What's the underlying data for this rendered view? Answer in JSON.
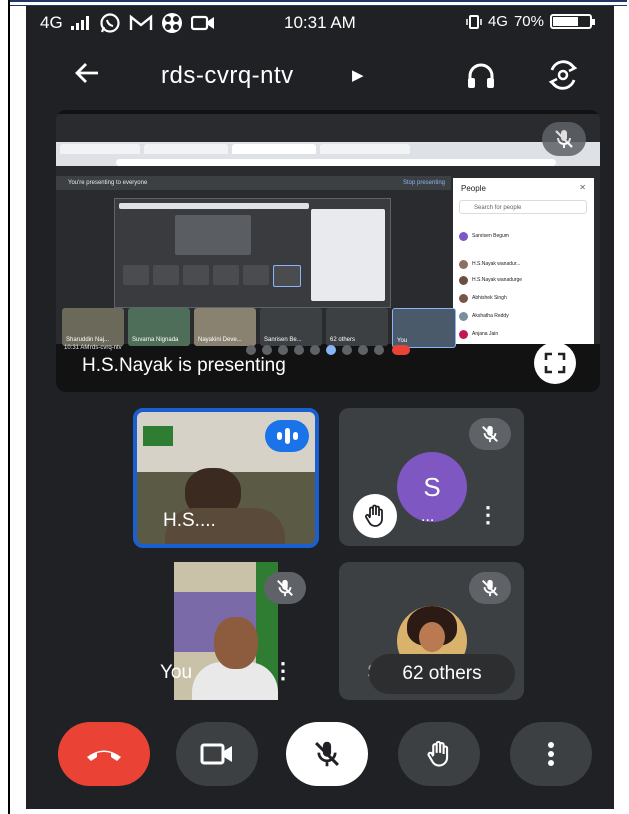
{
  "status_bar": {
    "network_left": "4G",
    "time": "10:31 AM",
    "network_right": "4G",
    "battery": "70%",
    "battery_level": 0.7
  },
  "header": {
    "meeting_code": "rds-cvrq-ntv"
  },
  "presentation": {
    "label": "H.S.Nayak is presenting",
    "shared_screen": {
      "presenting_bar": "You're presenting to everyone",
      "stop_presenting": "Stop presenting",
      "people_title": "People",
      "people_search": "Search for people",
      "people_rows": [
        "Sanrisen Begum",
        "H.S.Nayak wanadur...",
        "H.S.Nayak wanadurge",
        "Abhishek Singh",
        "Akshatha Reddy",
        "Anjana Jain"
      ],
      "strip_labels": [
        "Sharuddin Naj...",
        "Suvarna Nignada",
        "Nayakini Deve...",
        "Sanrisen Be...",
        "62 others",
        "You"
      ],
      "footer_time": "10:31 AM",
      "footer_code": "rds-cvrq-ntv"
    }
  },
  "tiles": {
    "presenter_name": "H.S....",
    "s_avatar_letter": "S",
    "s_name": "...",
    "you_label": "You",
    "others_underlay": "Su",
    "others_label": "62 others"
  },
  "colors": {
    "end_call": "#ea4335",
    "speaking": "#1a73e8",
    "avatar_s": "#7e57c2",
    "background": "#202124"
  },
  "icons": {
    "back": "arrow-left-icon",
    "audio": "headphones-icon",
    "switch_camera": "switch-camera-icon",
    "fullscreen": "fullscreen-icon",
    "end_call": "end-call-icon",
    "camera": "video-camera-icon",
    "mic": "mic-off-icon",
    "hand": "raise-hand-icon",
    "more": "more-vert-icon"
  }
}
